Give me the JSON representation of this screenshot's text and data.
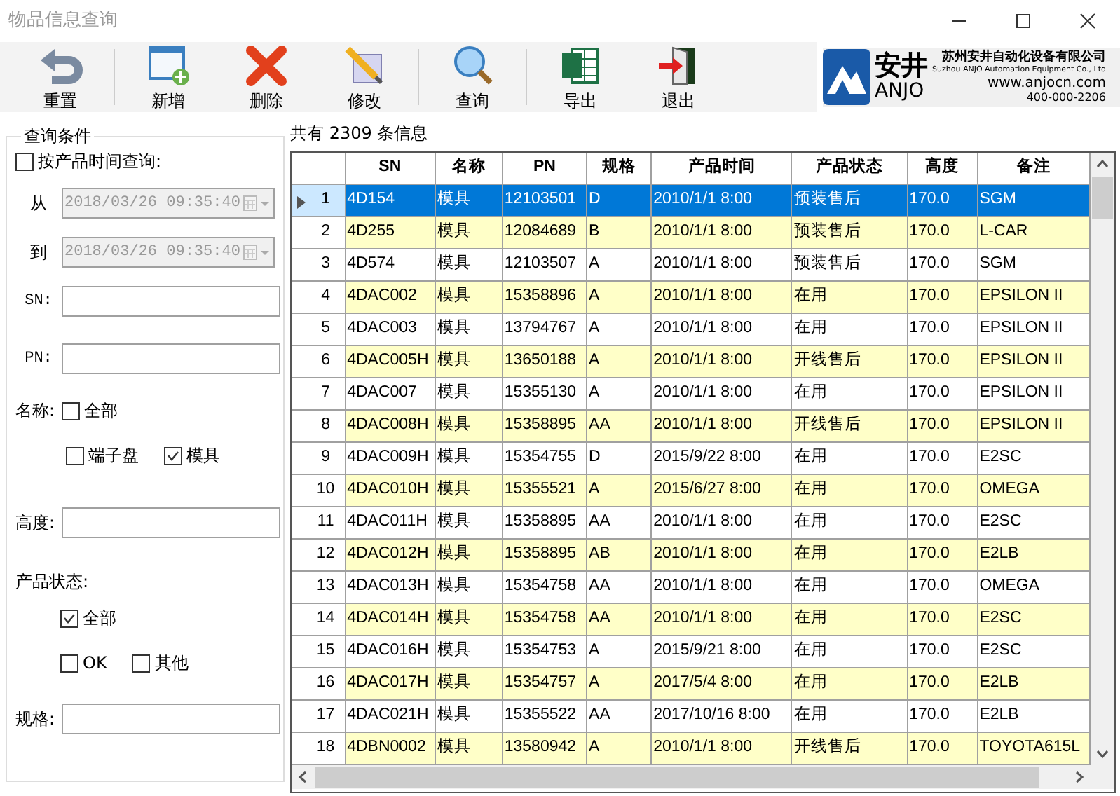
{
  "window": {
    "title": "物品信息查询"
  },
  "toolbar": [
    {
      "kind": "button",
      "label": "重置"
    },
    {
      "kind": "separator"
    },
    {
      "kind": "button",
      "label": "新增"
    },
    {
      "kind": "button",
      "label": "删除"
    },
    {
      "kind": "button",
      "label": "修改"
    },
    {
      "kind": "separator"
    },
    {
      "kind": "button",
      "label": "查询"
    },
    {
      "kind": "separator"
    },
    {
      "kind": "button",
      "label": "导出"
    },
    {
      "kind": "button",
      "label": "退出"
    }
  ],
  "logo": {
    "mark": "安井",
    "name": "ANJO",
    "company": "苏州安井自动化设备有限公司",
    "company_en": "Suzhou ANJO Automation Equipment Co., Ltd",
    "website": "www.anjocn.com",
    "phone": "400-000-2206"
  },
  "query_panel": {
    "title": "查询条件",
    "time_filter": {
      "label": "按产品时间查询:",
      "checked": false
    },
    "dates": [
      {
        "label": "从",
        "value": "2018/03/26 09:35:40",
        "disabled": true
      },
      {
        "label": "到",
        "value": "2018/03/26 09:35:40",
        "disabled": true
      }
    ],
    "sn": {
      "label": "SN:"
    },
    "pn": {
      "label": "PN:"
    },
    "name_filter": {
      "label": "名称:",
      "lines": [
        [
          {
            "label": "全部",
            "checked": false
          }
        ],
        [
          {
            "label": "端子盘",
            "checked": false
          },
          {
            "label": "模具",
            "checked": true
          }
        ]
      ]
    },
    "height": {
      "label": "高度:"
    },
    "status_filter": {
      "label": "产品状态:",
      "lines": [
        [
          {
            "label": "全部",
            "checked": true
          }
        ],
        [
          {
            "label": "OK",
            "checked": false
          },
          {
            "label": "其他",
            "checked": false
          }
        ]
      ]
    },
    "spec": {
      "label": "规格:"
    }
  },
  "result_count": "共有 2309 条信息",
  "table": {
    "columns": [
      "SN",
      "名称",
      "PN",
      "规格",
      "产品时间",
      "产品状态",
      "高度",
      "备注"
    ],
    "rows": [
      {
        "index": "1",
        "selected": true,
        "cells": [
          "4D154",
          "模具",
          "12103501",
          "D",
          "2010/1/1 8:00",
          "预装售后",
          "170.0",
          "SGM"
        ]
      },
      {
        "index": "2",
        "selected": false,
        "cells": [
          "4D255",
          "模具",
          "12084689",
          "B",
          "2010/1/1 8:00",
          "预装售后",
          "170.0",
          "L-CAR"
        ]
      },
      {
        "index": "3",
        "selected": false,
        "cells": [
          "4D574",
          "模具",
          "12103507",
          "A",
          "2010/1/1 8:00",
          "预装售后",
          "170.0",
          "SGM"
        ]
      },
      {
        "index": "4",
        "selected": false,
        "cells": [
          "4DAC002",
          "模具",
          "15358896",
          "A",
          "2010/1/1 8:00",
          "在用",
          "170.0",
          "EPSILON II"
        ]
      },
      {
        "index": "5",
        "selected": false,
        "cells": [
          "4DAC003",
          "模具",
          "13794767",
          "A",
          "2010/1/1 8:00",
          "在用",
          "170.0",
          "EPSILON II"
        ]
      },
      {
        "index": "6",
        "selected": false,
        "cells": [
          "4DAC005H",
          "模具",
          "13650188",
          "A",
          "2010/1/1 8:00",
          "开线售后",
          "170.0",
          "EPSILON II"
        ]
      },
      {
        "index": "7",
        "selected": false,
        "cells": [
          "4DAC007",
          "模具",
          "15355130",
          "A",
          "2010/1/1 8:00",
          "在用",
          "170.0",
          "EPSILON II"
        ]
      },
      {
        "index": "8",
        "selected": false,
        "cells": [
          "4DAC008H",
          "模具",
          "15358895",
          "AA",
          "2010/1/1 8:00",
          "开线售后",
          "170.0",
          "EPSILON II"
        ]
      },
      {
        "index": "9",
        "selected": false,
        "cells": [
          "4DAC009H",
          "模具",
          "15354755",
          "D",
          "2015/9/22 8:00",
          "在用",
          "170.0",
          "E2SC"
        ]
      },
      {
        "index": "10",
        "selected": false,
        "cells": [
          "4DAC010H",
          "模具",
          "15355521",
          "A",
          "2015/6/27 8:00",
          "在用",
          "170.0",
          "OMEGA"
        ]
      },
      {
        "index": "11",
        "selected": false,
        "cells": [
          "4DAC011H",
          "模具",
          "15358895",
          "AA",
          "2010/1/1 8:00",
          "在用",
          "170.0",
          "E2SC"
        ]
      },
      {
        "index": "12",
        "selected": false,
        "cells": [
          "4DAC012H",
          "模具",
          "15358895",
          "AB",
          "2010/1/1 8:00",
          "在用",
          "170.0",
          "E2LB"
        ]
      },
      {
        "index": "13",
        "selected": false,
        "cells": [
          "4DAC013H",
          "模具",
          "15354758",
          "AA",
          "2010/1/1 8:00",
          "在用",
          "170.0",
          "OMEGA"
        ]
      },
      {
        "index": "14",
        "selected": false,
        "cells": [
          "4DAC014H",
          "模具",
          "15354758",
          "AA",
          "2010/1/1 8:00",
          "在用",
          "170.0",
          "E2SC"
        ]
      },
      {
        "index": "15",
        "selected": false,
        "cells": [
          "4DAC016H",
          "模具",
          "15354753",
          "A",
          "2015/9/21 8:00",
          "在用",
          "170.0",
          "E2SC"
        ]
      },
      {
        "index": "16",
        "selected": false,
        "cells": [
          "4DAC017H",
          "模具",
          "15354757",
          "A",
          "2017/5/4 8:00",
          "在用",
          "170.0",
          "E2LB"
        ]
      },
      {
        "index": "17",
        "selected": false,
        "cells": [
          "4DAC021H",
          "模具",
          "15355522",
          "AA",
          "2017/10/16 8:00",
          "在用",
          "170.0",
          "E2LB"
        ]
      },
      {
        "index": "18",
        "selected": false,
        "cells": [
          "4DBN0002",
          "模具",
          "13580942",
          "A",
          "2010/1/1 8:00",
          "开线售后",
          "170.0",
          "TOYOTA615L"
        ]
      }
    ]
  }
}
